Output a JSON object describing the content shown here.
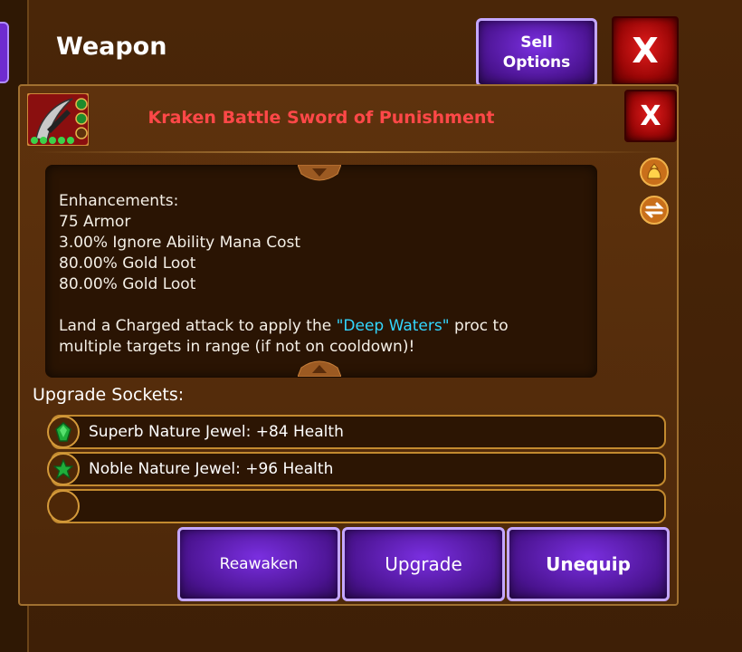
{
  "header": {
    "title": "Weapon",
    "sell_label_line1": "Sell",
    "sell_label_line2": "Options",
    "close_label": "X"
  },
  "item": {
    "name": "Kraken Battle Sword of Punishment",
    "name_color": "#ff4848",
    "close_label": "X"
  },
  "description": {
    "heading": "Enhancements:",
    "enhancements": [
      "75 Armor",
      "3.00% Ignore Ability Mana Cost",
      "80.00% Gold Loot",
      "80.00% Gold Loot"
    ],
    "proc_before": "Land a Charged attack to apply the ",
    "proc_name": "\"Deep Waters\"",
    "proc_after_line1": " proc to",
    "proc_line2": "multiple targets in range (if not on cooldown)!"
  },
  "sockets": {
    "label": "Upgrade Sockets:",
    "items": [
      {
        "text": "Superb Nature Jewel: +84 Health",
        "icon": "green-gem-icon"
      },
      {
        "text": "Noble Nature Jewel: +96 Health",
        "icon": "green-star-gem-icon"
      },
      {
        "text": "",
        "icon": "empty-socket"
      }
    ]
  },
  "actions": {
    "reawaken": "Reawaken",
    "upgrade": "Upgrade",
    "unequip": "Unequip"
  },
  "colors": {
    "accent_purple": "#6f2bd0",
    "close_red": "#c01010",
    "proc_cyan": "#33d7ff",
    "panel_brown": "#5e320d"
  }
}
